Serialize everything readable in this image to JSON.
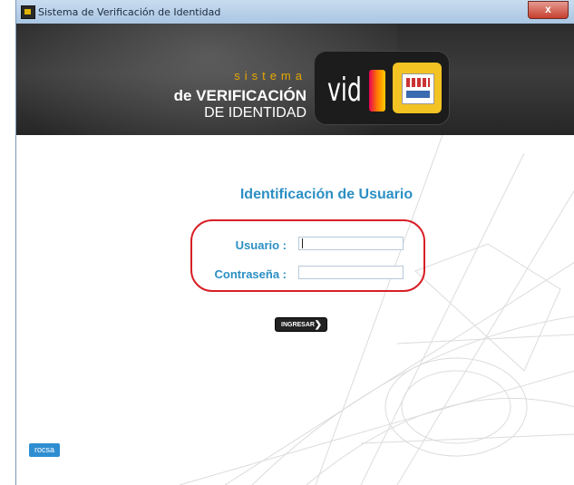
{
  "window": {
    "title": "Sistema de Verificación de Identidad",
    "close_label": "x"
  },
  "banner": {
    "line1": "sistema",
    "line2": "de VERIFICACIÓN",
    "line3": "DE IDENTIDAD",
    "logo_text": "vid"
  },
  "form": {
    "title": "Identificación de Usuario",
    "user_label": "Usuario :",
    "user_value": "",
    "pass_label": "Contraseña :",
    "pass_value": "",
    "submit_label": "INGRESAR",
    "submit_icon": "chevron-right-icon"
  },
  "footer": {
    "logo_text": "rocsa"
  },
  "colors": {
    "accent": "#2b8fc4",
    "highlight": "#d81f26",
    "banner_bg": "#2c2c2c"
  }
}
